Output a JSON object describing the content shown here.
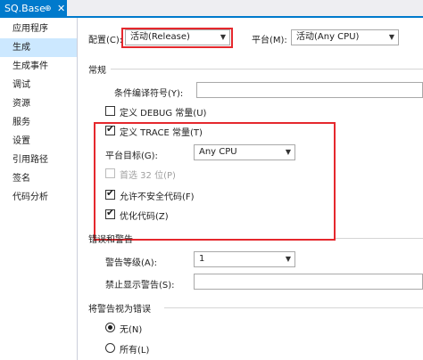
{
  "tab": {
    "title": "SQ.Base",
    "pin_glyph": "⊕",
    "close_glyph": "✕"
  },
  "nav": {
    "items": [
      {
        "label": "应用程序"
      },
      {
        "label": "生成"
      },
      {
        "label": "生成事件"
      },
      {
        "label": "调试"
      },
      {
        "label": "资源"
      },
      {
        "label": "服务"
      },
      {
        "label": "设置"
      },
      {
        "label": "引用路径"
      },
      {
        "label": "签名"
      },
      {
        "label": "代码分析"
      }
    ],
    "active_index": 1
  },
  "config": {
    "label": "配置(C):",
    "value": "活动(Release)",
    "platform_label": "平台(M):",
    "platform_value": "活动(Any CPU)"
  },
  "general": {
    "title": "常规",
    "symbols_label": "条件编译符号(Y):",
    "symbols_value": "",
    "debug_label": "定义 DEBUG 常量(U)",
    "debug_checked": false,
    "trace_label": "定义 TRACE 常量(T)",
    "trace_checked": true,
    "platform_target_label": "平台目标(G):",
    "platform_target_value": "Any CPU",
    "prefer32_label": "首选 32 位(P)",
    "prefer32_checked": false,
    "unsafe_label": "允许不安全代码(F)",
    "unsafe_checked": true,
    "optimize_label": "优化代码(Z)",
    "optimize_checked": true
  },
  "errors": {
    "title": "错误和警告",
    "warning_level_label": "警告等级(A):",
    "warning_level_value": "1",
    "suppress_label": "禁止显示警告(S):",
    "suppress_value": ""
  },
  "treat_warnings": {
    "title": "将警告视为错误",
    "none_label": "无(N)",
    "none_selected": true,
    "all_label": "所有(L)",
    "all_selected": false
  },
  "colors": {
    "accent": "#007acc",
    "highlight": "#e5282d",
    "nav_active": "#cce8ff"
  }
}
